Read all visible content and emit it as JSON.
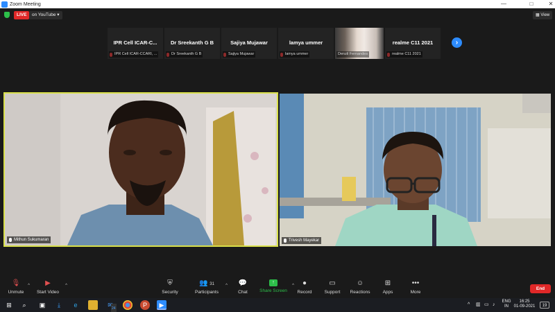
{
  "window": {
    "title": "Zoom Meeting",
    "min": "—",
    "max": "□",
    "close": "✕"
  },
  "meeting": {
    "live_badge": "LIVE",
    "stream_target": "on YouTube ▾",
    "view_label": "▦ View"
  },
  "participants_strip": [
    {
      "name": "IPR Cell  ICAR-C...",
      "label": "IPR Cell  ICAR-CCARI, ...",
      "has_video": false
    },
    {
      "name": "Dr Sreekanth G B",
      "label": "Dr Sreekanth G B",
      "has_video": false
    },
    {
      "name": "Sajiya Mujawar",
      "label": "Sajiya Mujawar",
      "has_video": false
    },
    {
      "name": "lamya ummer",
      "label": "lamya ummer",
      "has_video": false
    },
    {
      "name": "",
      "label": "Denzil Fernandes",
      "has_video": true
    },
    {
      "name": "realme C11 2021",
      "label": "realme C11 2021",
      "has_video": false
    }
  ],
  "strip_next": "›",
  "videos": {
    "left": {
      "label": "Mithun Sukumaran",
      "active_speaker": true
    },
    "right": {
      "label": "Trivesh Mayekar",
      "active_speaker": false
    }
  },
  "toolbar": {
    "unmute": "Unmute",
    "start_video": "Start Video",
    "security": "Security",
    "participants": "Participants",
    "participants_count": "31",
    "chat": "Chat",
    "share_screen": "Share Screen",
    "record": "Record",
    "support": "Support",
    "reactions": "Reactions",
    "apps": "Apps",
    "more": "More",
    "end": "End"
  },
  "taskbar": {
    "lang_top": "ENG",
    "lang_bottom": "IN",
    "time": "16:25",
    "date": "01-09-2021",
    "notif_count": "19",
    "mail_badge": "24"
  },
  "colors": {
    "accent": "#2d8cff",
    "live": "#e02828",
    "active_speaker_border": "#d9e04a",
    "share_green": "#2dbf4a"
  }
}
